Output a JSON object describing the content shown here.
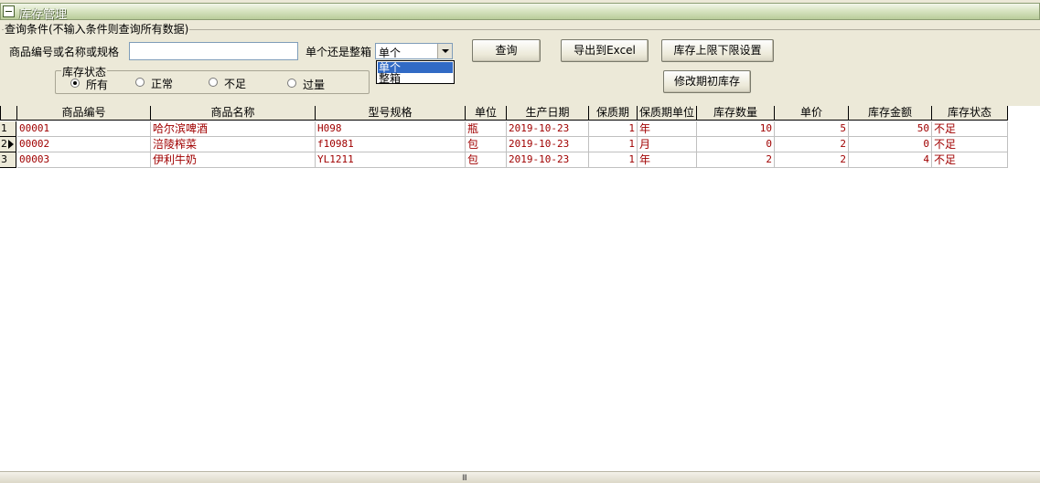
{
  "window": {
    "title": "库存管理"
  },
  "query": {
    "legend": "查询条件(不输入条件则查询所有数据)",
    "code_label": "商品编号或名称或规格",
    "code_value": "",
    "unit_label": "单个还是整箱",
    "unit_selected": "单个",
    "unit_options": [
      "单个",
      "整箱"
    ],
    "status_legend": "库存状态",
    "status_options": [
      "所有",
      "正常",
      "不足",
      "过量"
    ],
    "status_selected": "所有"
  },
  "buttons": {
    "query": "查询",
    "export": "导出到Excel",
    "limit_settings": "库存上限下限设置",
    "edit_initial": "修改期初库存"
  },
  "grid": {
    "columns": [
      "商品编号",
      "商品名称",
      "型号规格",
      "单位",
      "生产日期",
      "保质期",
      "保质期单位",
      "库存数量",
      "单价",
      "库存金额",
      "库存状态"
    ],
    "rows": [
      {
        "num": "1",
        "cells": [
          "00001",
          "哈尔滨啤酒",
          "H098",
          "瓶",
          "2019-10-23",
          "1",
          "年",
          "10",
          "5",
          "50",
          "不足"
        ]
      },
      {
        "num": "2",
        "cells": [
          "00002",
          "涪陵榨菜",
          "f10981",
          "包",
          "2019-10-23",
          "1",
          "月",
          "0",
          "2",
          "0",
          "不足"
        ]
      },
      {
        "num": "3",
        "cells": [
          "00003",
          "伊利牛奶",
          "YL1211",
          "包",
          "2019-10-23",
          "1",
          "年",
          "2",
          "2",
          "4",
          "不足"
        ]
      }
    ],
    "current_row": 2
  },
  "statusbar": {
    "grip": "III"
  },
  "colors": {
    "data_text": "#a00000",
    "selection": "#316ac5",
    "title_bar": "#c7d6ad"
  }
}
